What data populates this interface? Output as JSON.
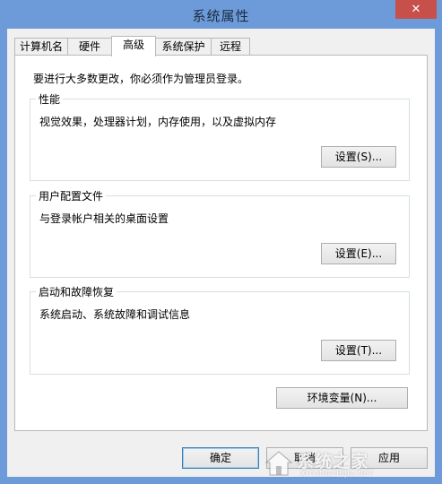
{
  "window": {
    "title": "系统属性",
    "close_label": "✕"
  },
  "tabs": [
    {
      "label": "计算机名",
      "active": false
    },
    {
      "label": "硬件",
      "active": false
    },
    {
      "label": "高级",
      "active": true
    },
    {
      "label": "系统保护",
      "active": false
    },
    {
      "label": "远程",
      "active": false
    }
  ],
  "advanced": {
    "admin_note": "要进行大多数更改，你必须作为管理员登录。",
    "performance": {
      "title": "性能",
      "description": "视觉效果，处理器计划，内存使用，以及虚拟内存",
      "button": "设置(S)..."
    },
    "user_profiles": {
      "title": "用户配置文件",
      "description": "与登录帐户相关的桌面设置",
      "button": "设置(E)..."
    },
    "startup_recovery": {
      "title": "启动和故障恢复",
      "description": "系统启动、系统故障和调试信息",
      "button": "设置(T)..."
    },
    "env_vars_button": "环境变量(N)..."
  },
  "footer": {
    "ok": "确定",
    "cancel": "取消",
    "apply": "应用"
  },
  "watermark": {
    "text": "系统之家",
    "sub": "XITONGZHIJIA.NET"
  },
  "colors": {
    "titlebar": "#6d9bd9",
    "close": "#c7504b",
    "client": "#f0f0f0"
  }
}
